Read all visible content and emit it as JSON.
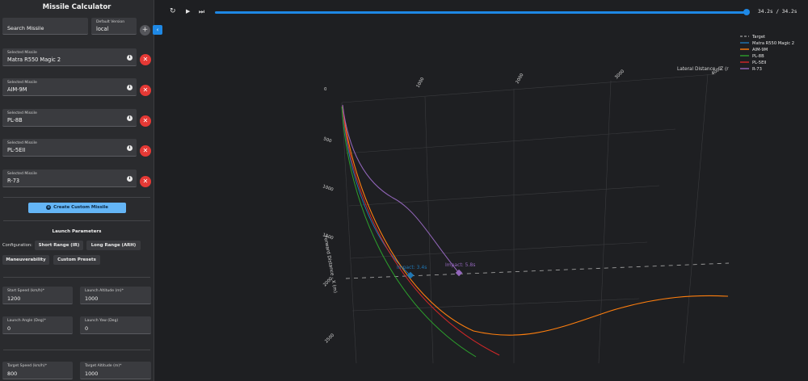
{
  "sidebar": {
    "title": "Missile Calculator",
    "search": {
      "label": "Search Missile"
    },
    "version": {
      "label": "Default Version",
      "value": "local"
    },
    "add_icon": "+",
    "collapse_icon": "‹",
    "selected_label": "Selected Missile",
    "selected_missiles": [
      {
        "name": "Matra R550 Magic 2"
      },
      {
        "name": "AIM-9M"
      },
      {
        "name": "PL-8B"
      },
      {
        "name": "PL-5EII"
      },
      {
        "name": "R-73"
      }
    ],
    "info_icon": "i",
    "remove_icon": "✕",
    "create_button": "Create Custom Missile"
  },
  "launch": {
    "title": "Launch Parameters",
    "config_label": "Configuration:",
    "presets": [
      "Short Range (IR)",
      "Long Range (ARH)",
      "Maneuverability",
      "Custom Presets"
    ],
    "fields": [
      {
        "label": "Start Speed (km/h)*",
        "value": "1200"
      },
      {
        "label": "Launch Altitude (m)*",
        "value": "1000"
      },
      {
        "label": "Launch Angle (Deg)*",
        "value": "0"
      },
      {
        "label": "Launch Yaw (Deg)",
        "value": "0"
      },
      {
        "label": "Target Speed (km/h)*",
        "value": "800"
      },
      {
        "label": "Target Altitude (m)*",
        "value": "1000"
      }
    ]
  },
  "player": {
    "replay_icon": "↻",
    "play_icon": "▶",
    "skip_icon": "⏭",
    "time": "34.2s / 34.2s",
    "progress": 1.0
  },
  "plot": {
    "z_axis_title": "Lateral Distance - Z (r",
    "x_axis_title": "Forward Distance - X (m)",
    "z_ticks": [
      "0",
      "1000",
      "2000",
      "3000",
      "4000"
    ],
    "x_ticks": [
      "500",
      "1000",
      "1500",
      "2000",
      "2500"
    ],
    "legend": [
      {
        "name": "Target",
        "color": "#9e9e9e",
        "dash": true
      },
      {
        "name": "Matra R550 Magic 2",
        "color": "#1f77b4",
        "dash": false
      },
      {
        "name": "AIM-9M",
        "color": "#ff7f0e",
        "dash": false
      },
      {
        "name": "PL-8B",
        "color": "#2ca02c",
        "dash": false
      },
      {
        "name": "PL-5EII",
        "color": "#d62728",
        "dash": false
      },
      {
        "name": "R-73",
        "color": "#9467bd",
        "dash": false
      }
    ],
    "impacts": [
      {
        "label": "Impact: 3.4s",
        "color": "#1f77b4"
      },
      {
        "label": "Impact: 5.8s",
        "color": "#9467bd"
      }
    ]
  }
}
